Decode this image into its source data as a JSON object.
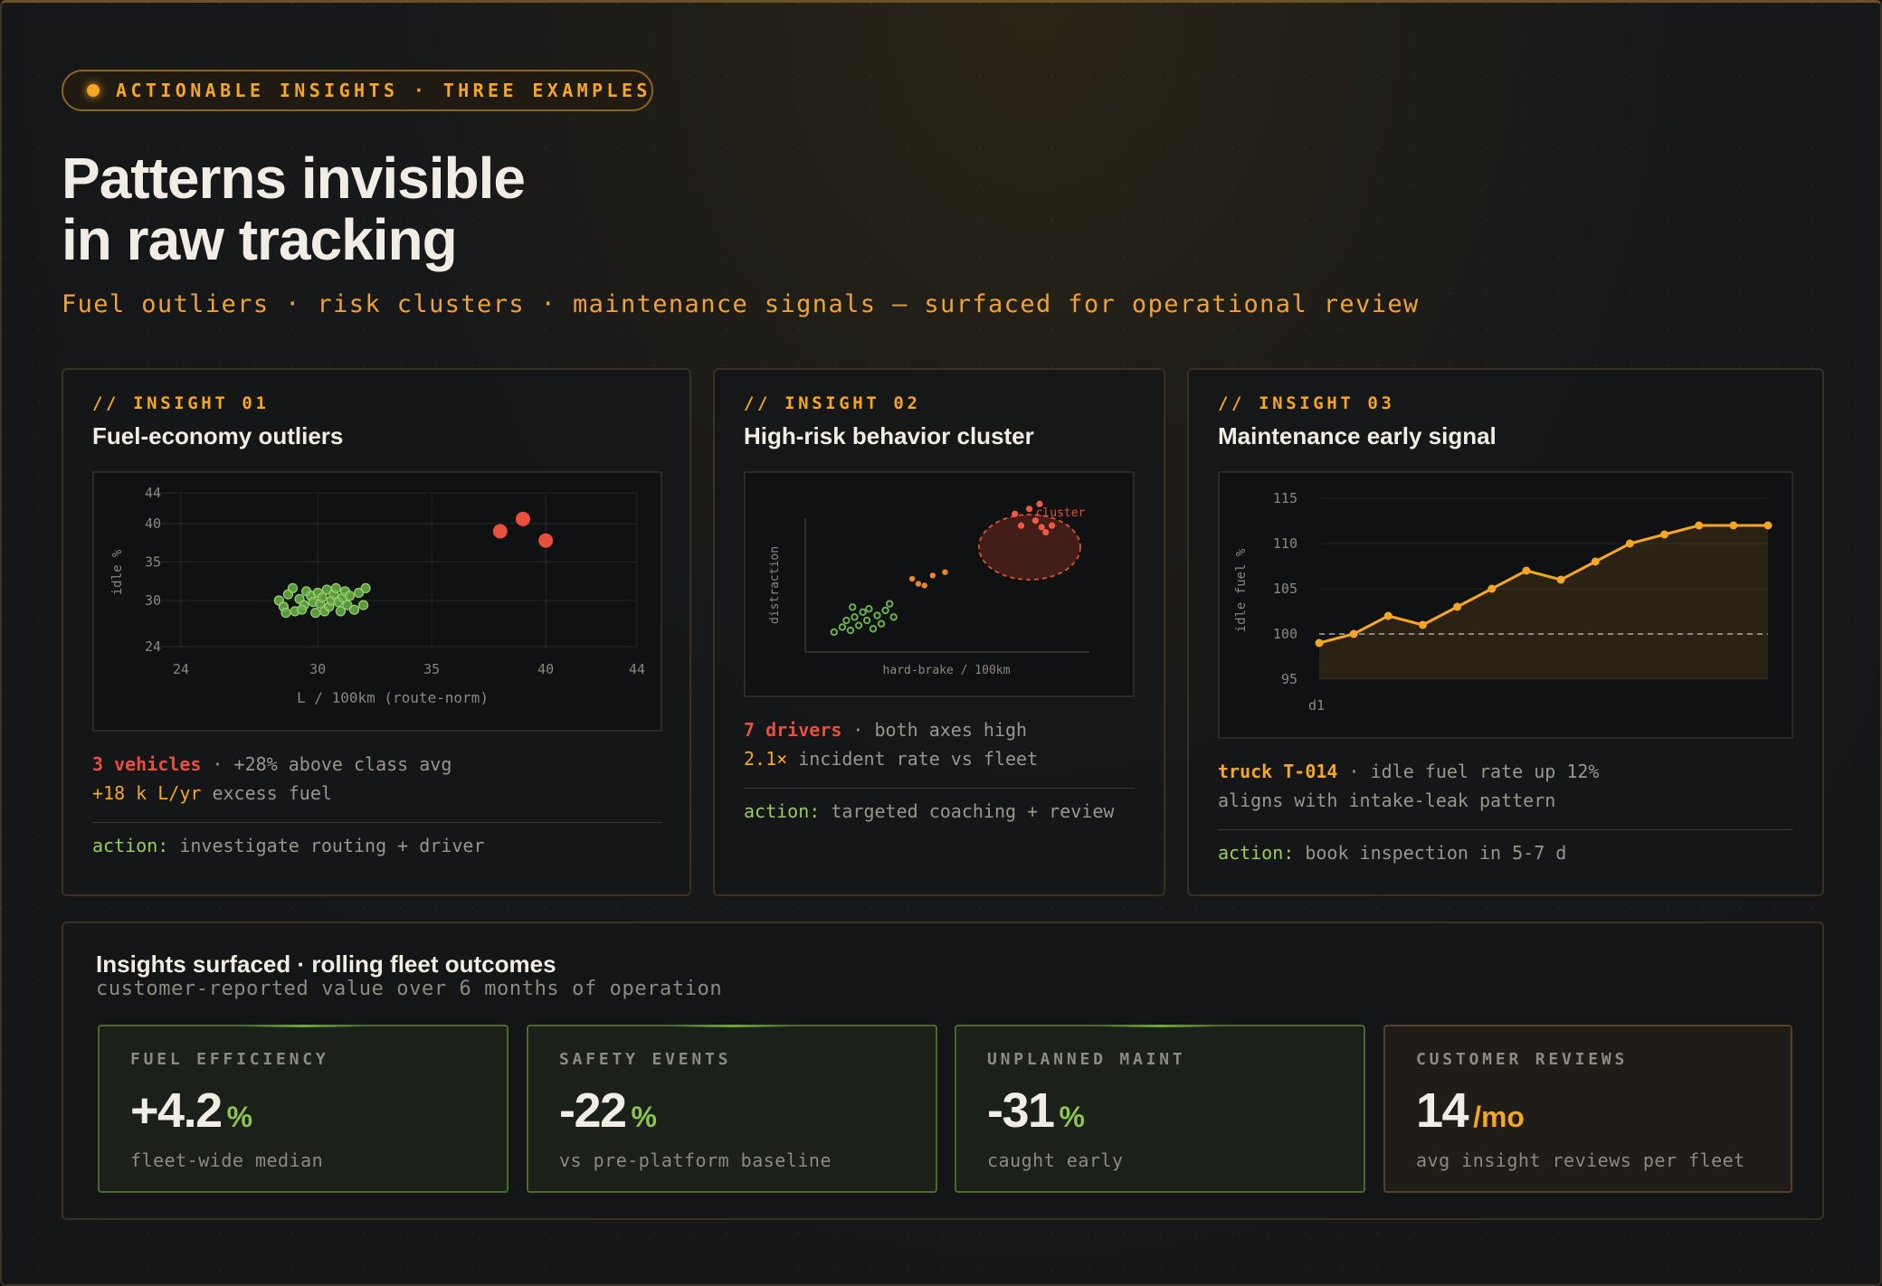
{
  "header": {
    "badge": "ACTIONABLE INSIGHTS · THREE EXAMPLES",
    "title_line1": "Patterns invisible",
    "title_line2": "in raw tracking",
    "subtitle": "Fuel outliers · risk clusters · maintenance signals — surfaced for operational review"
  },
  "colors": {
    "accent": "#f5a623",
    "risk": "#e8503c",
    "normal": "#6ab04c",
    "good": "#9acd5a"
  },
  "insights": [
    {
      "kicker": "// INSIGHT 01",
      "title": "Fuel-economy outliers",
      "highlight": "3 vehicles",
      "line1_rest": " · +28% above class avg",
      "line2_highlight": "+18 k L/yr",
      "line2_rest": " excess fuel",
      "action_label": "action:",
      "action_text": " investigate routing + driver"
    },
    {
      "kicker": "// INSIGHT 02",
      "title": "High-risk behavior cluster",
      "highlight": "7 drivers",
      "line1_rest": " · both axes high",
      "line2_highlight": "2.1×",
      "line2_rest": " incident rate vs fleet",
      "action_label": "action:",
      "action_text": " targeted coaching + review"
    },
    {
      "kicker": "// INSIGHT 03",
      "title": "Maintenance early signal",
      "highlight": "truck T-014",
      "line1_rest": " · idle fuel rate up 12%",
      "line2_text": "aligns with intake-leak pattern",
      "action_label": "action:",
      "action_text": " book inspection in 5-7 d"
    }
  ],
  "chart_data": [
    {
      "type": "scatter",
      "xlabel": "L / 100km (route-norm)",
      "ylabel": "idle %",
      "xticks": [
        "24",
        "30",
        "35",
        "40",
        "44"
      ],
      "yticks": [
        "44",
        "40",
        "35",
        "30",
        "24"
      ],
      "xlim": [
        24,
        44
      ],
      "ylim": [
        24,
        44
      ],
      "grid": true,
      "series": [
        {
          "role": "normal",
          "points": [
            [
              28.3,
              30.0
            ],
            [
              28.5,
              29.2
            ],
            [
              28.7,
              30.8
            ],
            [
              28.9,
              31.6
            ],
            [
              29.0,
              28.6
            ],
            [
              29.2,
              30.2
            ],
            [
              29.4,
              29.4
            ],
            [
              29.5,
              31.2
            ],
            [
              29.7,
              30.6
            ],
            [
              29.8,
              29.8
            ],
            [
              29.9,
              28.4
            ],
            [
              30.0,
              31.0
            ],
            [
              30.1,
              29.6
            ],
            [
              30.2,
              30.4
            ],
            [
              30.3,
              28.6
            ],
            [
              30.4,
              31.4
            ],
            [
              30.5,
              29.2
            ],
            [
              30.6,
              30.0
            ],
            [
              30.7,
              30.8
            ],
            [
              30.8,
              31.6
            ],
            [
              30.9,
              29.8
            ],
            [
              31.0,
              28.6
            ],
            [
              31.1,
              30.4
            ],
            [
              31.2,
              31.2
            ],
            [
              31.3,
              29.4
            ],
            [
              31.4,
              30.6
            ],
            [
              31.6,
              28.8
            ],
            [
              31.8,
              31.0
            ],
            [
              32.0,
              29.4
            ],
            [
              32.1,
              31.6
            ],
            [
              28.6,
              28.4
            ],
            [
              29.3,
              28.8
            ]
          ]
        },
        {
          "role": "outlier",
          "points": [
            [
              38.0,
              39.0
            ],
            [
              39.0,
              40.6
            ],
            [
              40.0,
              37.8
            ]
          ]
        }
      ]
    },
    {
      "type": "scatter",
      "xlabel": "hard-brake / 100km",
      "ylabel": "distraction",
      "annotation": "cluster",
      "series": [
        {
          "role": "normal",
          "points": [
            [
              1.4,
              1.2
            ],
            [
              1.8,
              1.5
            ],
            [
              2.0,
              1.9
            ],
            [
              2.2,
              1.3
            ],
            [
              2.4,
              2.1
            ],
            [
              2.6,
              1.6
            ],
            [
              2.8,
              2.4
            ],
            [
              3.0,
              1.9
            ],
            [
              3.1,
              2.6
            ],
            [
              3.3,
              1.4
            ],
            [
              3.5,
              2.2
            ],
            [
              3.7,
              1.7
            ],
            [
              3.9,
              2.5
            ],
            [
              4.1,
              2.9
            ],
            [
              2.3,
              2.7
            ],
            [
              4.3,
              2.1
            ]
          ]
        },
        {
          "role": "mid",
          "points": [
            [
              5.2,
              4.4
            ],
            [
              5.5,
              4.1
            ],
            [
              5.8,
              4.0
            ],
            [
              6.2,
              4.6
            ],
            [
              6.8,
              4.8
            ]
          ]
        },
        {
          "role": "cluster",
          "points": [
            [
              10.2,
              8.3
            ],
            [
              10.5,
              7.6
            ],
            [
              10.9,
              8.6
            ],
            [
              11.2,
              7.9
            ],
            [
              11.5,
              7.5
            ],
            [
              11.7,
              7.2
            ],
            [
              12.0,
              7.6
            ],
            [
              11.4,
              8.9
            ]
          ]
        }
      ]
    },
    {
      "type": "area",
      "ylabel": "idle fuel %",
      "x_label_first": "d1",
      "yticks": [
        "115",
        "110",
        "105",
        "100",
        "95"
      ],
      "ylim": [
        95,
        115
      ],
      "baseline": 100,
      "values": [
        99.0,
        100.0,
        102.0,
        101.0,
        103.0,
        105.0,
        107.0,
        106.0,
        108.0,
        110.0,
        111.0,
        112.0,
        112.0,
        112.0
      ]
    }
  ],
  "outcomes": {
    "title": "Insights surfaced · rolling fleet outcomes",
    "subtitle": "customer-reported value over 6 months of operation",
    "kpis": [
      {
        "label": "FUEL EFFICIENCY",
        "value": "+4.2",
        "unit": "%",
        "caption": "fleet-wide median"
      },
      {
        "label": "SAFETY EVENTS",
        "value": "-22",
        "unit": "%",
        "caption": "vs pre-platform baseline"
      },
      {
        "label": "UNPLANNED MAINT",
        "value": "-31",
        "unit": "%",
        "caption": "caught early"
      },
      {
        "label": "CUSTOMER REVIEWS",
        "value": "14",
        "unit": "/mo",
        "caption": "avg insight reviews per fleet"
      }
    ]
  }
}
